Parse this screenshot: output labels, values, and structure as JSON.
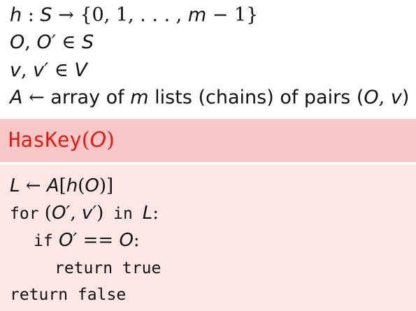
{
  "definitions": [
    {
      "id": "hash",
      "parts": [
        "h",
        " : ",
        "S",
        " → {0, 1, . . . , ",
        "m",
        " − 1}"
      ]
    },
    {
      "id": "objects",
      "parts": [
        "O",
        ", ",
        "O′",
        " ∈ ",
        "S"
      ]
    },
    {
      "id": "values",
      "parts": [
        "v",
        ", ",
        "v′",
        " ∈ ",
        "V"
      ]
    },
    {
      "id": "array",
      "parts": [
        "A",
        " ← ",
        "array of ",
        "m",
        " lists (chains) of pairs (",
        "O",
        ", ",
        "v",
        ")"
      ]
    }
  ],
  "function": {
    "name": "HasKey",
    "open_paren": "(",
    "param": "O",
    "close_paren": ")"
  },
  "code": {
    "line1": {
      "lhs": "L",
      "arrow": " ← ",
      "arr": "A",
      "bracket_open": "[",
      "fn": "h",
      "paren_open": "(",
      "arg": "O",
      "paren_close": ")",
      "bracket_close": "]"
    },
    "line2": {
      "kw_for": "for",
      "tuple_open": " (",
      "var1": "O′",
      "comma": ", ",
      "var2": "v′",
      "tuple_close": ")",
      "kw_in": " in ",
      "coll": "L",
      "colon": ":"
    },
    "line3": {
      "kw_if": "if",
      "lhs": " O′",
      "op": " == ",
      "rhs": "O",
      "colon": ":"
    },
    "line4": {
      "stmt": "return true"
    },
    "line5": {
      "stmt": "return false"
    }
  }
}
